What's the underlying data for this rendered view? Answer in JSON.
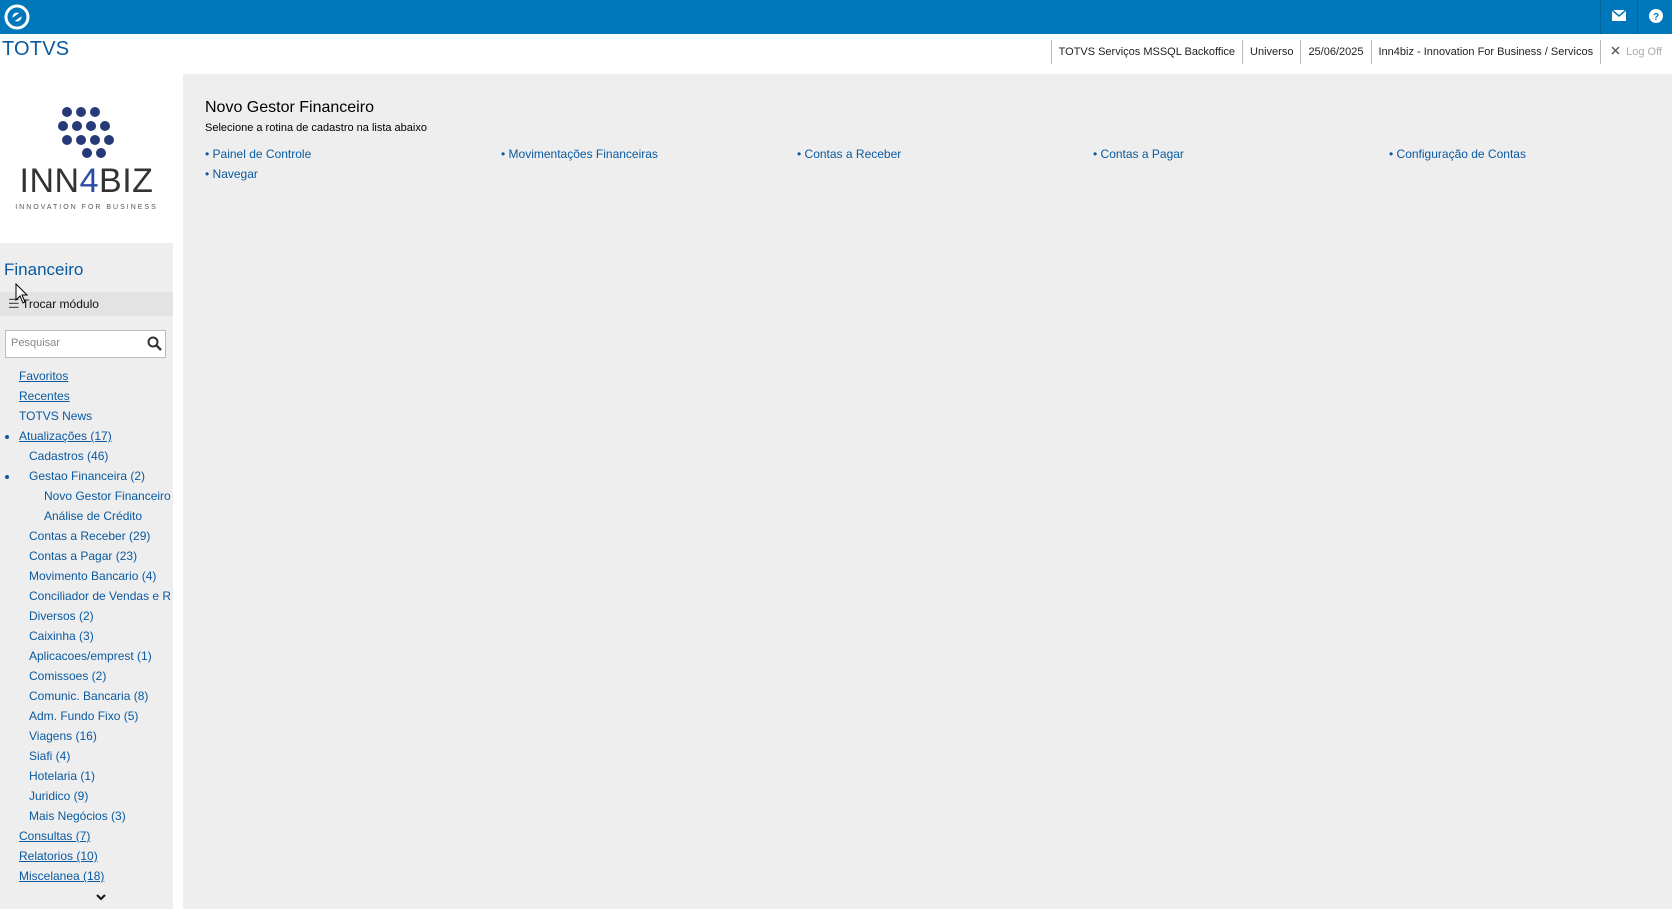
{
  "topbar": {
    "logo_icon": "totvs-logo-icon",
    "mail_icon": "envelope-icon",
    "help_icon": "question-icon",
    "color": "#0077bb"
  },
  "header": {
    "app_title": "TOTVS",
    "environment": "TOTVS Serviços MSSQL Backoffice",
    "workspace": "Universo",
    "date": "25/06/2025",
    "company": "Inn4biz - Innovation For Business / Servicos",
    "logoff_label": "Log Off"
  },
  "sidebar": {
    "logo": {
      "brand_a": "INN",
      "brand_b": "4",
      "brand_c": "BIZ",
      "tagline": "INNOVATION FOR BUSINESS"
    },
    "module_title": "Financeiro",
    "change_module_label": "Trocar módulo",
    "search_placeholder": "Pesquisar",
    "items": [
      {
        "label": "Favoritos",
        "level": 0
      },
      {
        "label": "Recentes",
        "level": 0
      },
      {
        "label": "TOTVS News",
        "level": 0
      },
      {
        "label": "Atualizações (17)",
        "level": 0,
        "expanded": true
      },
      {
        "label": "Cadastros (46)",
        "level": 1
      },
      {
        "label": "Gestao Financeira (2)",
        "level": 1,
        "expanded": true
      },
      {
        "label": "Novo Gestor Financeiro",
        "level": 2
      },
      {
        "label": "Análise de Crédito",
        "level": 2
      },
      {
        "label": "Contas a Receber (29)",
        "level": 1
      },
      {
        "label": "Contas a Pagar (23)",
        "level": 1
      },
      {
        "label": "Movimento Bancario (4)",
        "level": 1
      },
      {
        "label": "Conciliador de Vendas e R",
        "level": 1
      },
      {
        "label": "Diversos (2)",
        "level": 1
      },
      {
        "label": "Caixinha (3)",
        "level": 1
      },
      {
        "label": "Aplicacoes/emprest (1)",
        "level": 1
      },
      {
        "label": "Comissoes (2)",
        "level": 1
      },
      {
        "label": "Comunic. Bancaria (8)",
        "level": 1
      },
      {
        "label": "Adm. Fundo Fixo (5)",
        "level": 1
      },
      {
        "label": "Viagens (16)",
        "level": 1
      },
      {
        "label": "Siafi (4)",
        "level": 1
      },
      {
        "label": "Hotelaria (1)",
        "level": 1
      },
      {
        "label": "Juridico (9)",
        "level": 1
      },
      {
        "label": "Mais Negócios (3)",
        "level": 1
      },
      {
        "label": "Consultas (7)",
        "level": 0
      },
      {
        "label": "Relatorios (10)",
        "level": 0
      },
      {
        "label": "Miscelanea (18)",
        "level": 0
      }
    ]
  },
  "main": {
    "title": "Novo Gestor Financeiro",
    "subtitle": "Selecione a rotina de cadastro na lista abaixo",
    "routines": [
      "• Painel de Controle",
      "• Movimentações Financeiras",
      "• Contas a Receber",
      "• Contas a Pagar",
      "• Configuração de Contas",
      "• Navegar"
    ]
  }
}
